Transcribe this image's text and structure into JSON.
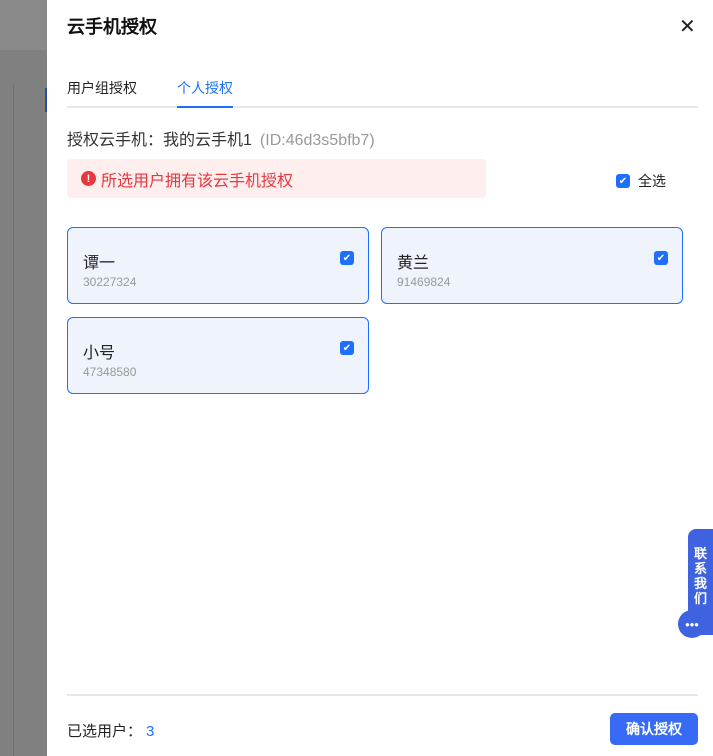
{
  "title": "云手机授权",
  "tabs": [
    {
      "label": "用户组授权"
    },
    {
      "label": "个人授权"
    }
  ],
  "phone": {
    "label": "授权云手机：",
    "name": "我的云手机1",
    "id": "(ID:46d3s5bfb7)"
  },
  "alert": "所选用户拥有该云手机授权",
  "select_all": "全选",
  "users": [
    {
      "name": "谭一",
      "id": "30227324",
      "checked": true
    },
    {
      "name": "黄兰",
      "id": "91469824",
      "checked": true
    },
    {
      "name": "小号",
      "id": "47348580",
      "checked": true
    }
  ],
  "footer": {
    "selected_label": "已选用户：",
    "selected_count": "3",
    "confirm": "确认授权"
  },
  "contact": "联系我们",
  "accent": "#1f6fff"
}
